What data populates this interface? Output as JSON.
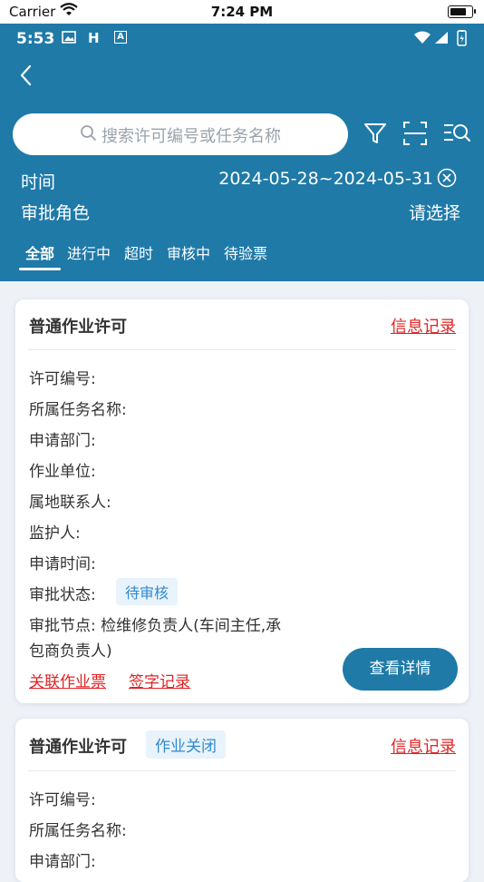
{
  "ios_status": {
    "carrier": "Carrier",
    "time": "7:24 PM"
  },
  "android_status": {
    "time": "5:53",
    "icons": [
      "image-icon",
      "H",
      "A"
    ]
  },
  "search": {
    "placeholder": "搜索许可编号或任务名称"
  },
  "filters": {
    "time_label": "时间",
    "time_value": "2024-05-28~2024-05-31",
    "role_label": "审批角色",
    "role_value": "请选择"
  },
  "tabs": [
    "全部",
    "进行中",
    "超时",
    "审核中",
    "待验票"
  ],
  "cards": [
    {
      "title": "普通作业许可",
      "info_link": "信息记录",
      "fields": [
        "许可编号:",
        "所属任务名称:",
        "申请部门:",
        "作业单位:",
        "属地联系人:",
        "监护人:",
        "申请时间:",
        "审批状态:"
      ],
      "status_badge": "待审核",
      "approval_node_line1": "审批节点: 检维修负责人(车间主任,承",
      "approval_node_line2": "包商负责人)",
      "link_ticket": "关联作业票",
      "link_sign": "签字记录",
      "detail_button": "查看详情"
    },
    {
      "title": "普通作业许可",
      "badge": "作业关闭",
      "info_link": "信息记录",
      "fields": [
        "许可编号:",
        "所属任务名称:",
        "申请部门:"
      ]
    }
  ],
  "colors": {
    "primary": "#1f7aa8",
    "link_red": "#e02323",
    "badge_blue": "#2f8bd0"
  }
}
